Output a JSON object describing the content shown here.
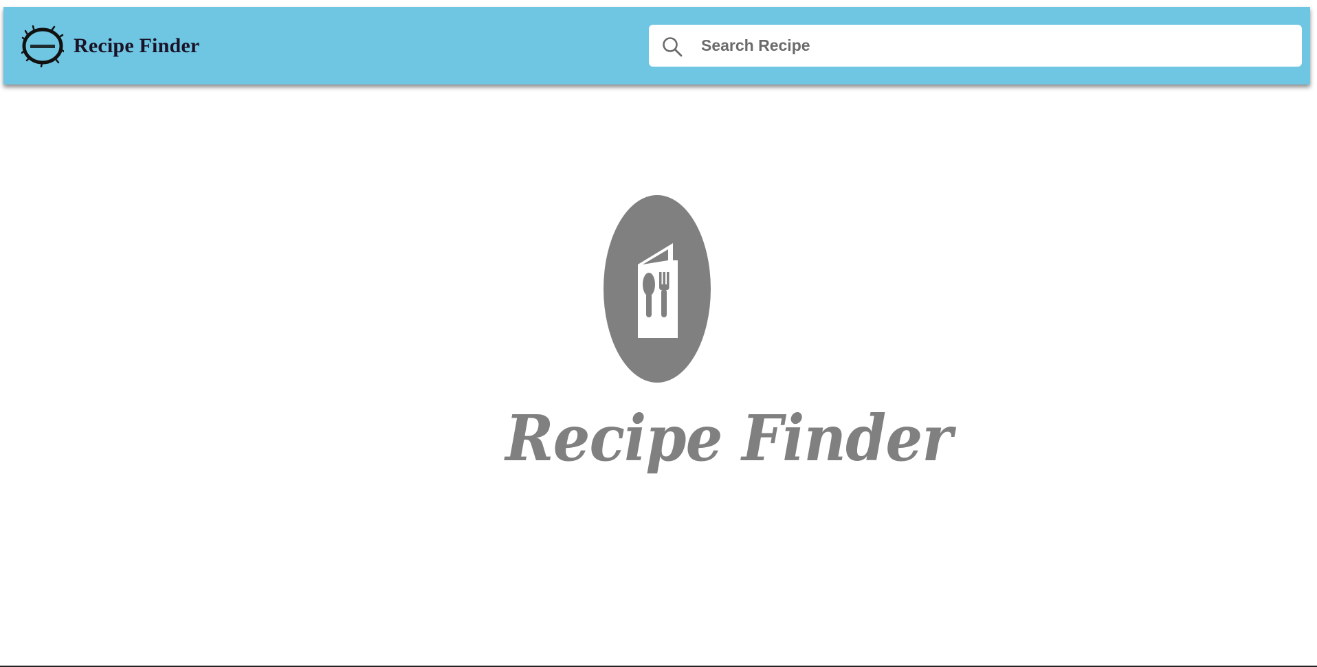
{
  "header": {
    "title": "Recipe Finder",
    "logo_text": "RecipeFinder",
    "background_color": "#6fc6e2"
  },
  "search": {
    "placeholder": "Search Recipe",
    "value": "",
    "icon": "search-icon"
  },
  "hero": {
    "title": "Recipe Finder",
    "icon": "menu-card-utensils-icon",
    "color": "#808080"
  }
}
